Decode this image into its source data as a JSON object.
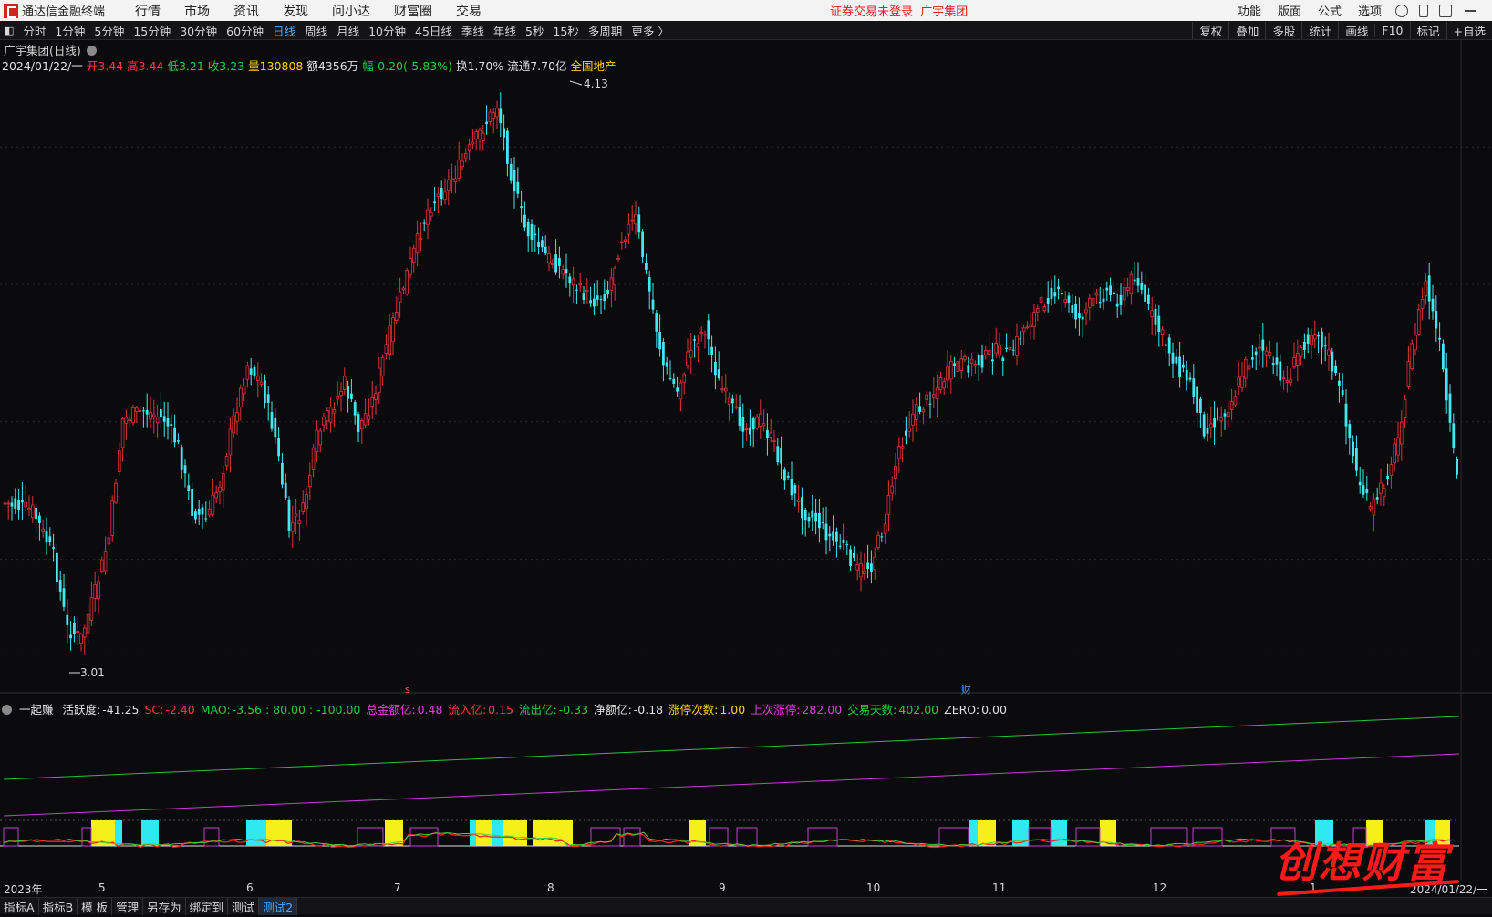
{
  "app": {
    "title": "通达信金融终端",
    "login_status": "证券交易未登录",
    "stock_title": "广宇集团"
  },
  "menu": [
    "行情",
    "市场",
    "资讯",
    "发现",
    "问小达",
    "财富圈",
    "交易"
  ],
  "top_right": [
    "功能",
    "版面",
    "公式",
    "选项"
  ],
  "periods": [
    "分时",
    "1分钟",
    "5分钟",
    "15分钟",
    "30分钟",
    "60分钟",
    "日线",
    "周线",
    "月线",
    "10分钟",
    "45日线",
    "季线",
    "年线",
    "5秒",
    "15秒",
    "多周期",
    "更多 〉"
  ],
  "active_period": "日线",
  "right_tools": [
    "复权",
    "叠加",
    "多股",
    "统计",
    "画线",
    "F10",
    "标记",
    "+自选"
  ],
  "chart_header": {
    "name": "广宇集团(日线)"
  },
  "quote": {
    "date": "2024/01/22/一",
    "open_label": "开",
    "open": "3.44",
    "high_label": "高",
    "high": "3.44",
    "low_label": "低",
    "low": "3.21",
    "close_label": "收",
    "close": "3.23",
    "volume_label": "量",
    "volume": "130808",
    "amount_label": "额",
    "amount": "4356万",
    "change_label": "幅",
    "change": "-0.20(-5.83%)",
    "turnover_label": "换",
    "turnover": "1.70%",
    "float_label": "流通",
    "float": "7.70亿",
    "sector": "全国地产"
  },
  "price_annotations": {
    "high": "4.13",
    "low": "3.01"
  },
  "markers": {
    "event1": "s",
    "event2": "财"
  },
  "indicator": {
    "name": "一起赚",
    "items": [
      {
        "label": "活跃度:",
        "value": "-41.25",
        "color": "w"
      },
      {
        "label": "SC:",
        "value": "-2.40",
        "color": "r"
      },
      {
        "label": "MAO:",
        "value": "-3.56 : 80.00 : -100.00",
        "color": "g"
      },
      {
        "label": "总金额亿:",
        "value": "0.48",
        "color": "m"
      },
      {
        "label": "流入亿:",
        "value": "0.15",
        "color": "r"
      },
      {
        "label": "流出亿:",
        "value": "-0.33",
        "color": "g"
      },
      {
        "label": "净额亿:",
        "value": "-0.18",
        "color": "w"
      },
      {
        "label": "涨停次数:",
        "value": "1.00",
        "color": "y"
      },
      {
        "label": "上次涨停:",
        "value": "282.00",
        "color": "m"
      },
      {
        "label": "交易天数:",
        "value": "402.00",
        "color": "g"
      },
      {
        "label": "ZERO:",
        "value": "0.00",
        "color": "w"
      }
    ]
  },
  "date_axis": {
    "year": "2023年",
    "months": [
      "5",
      "6",
      "7",
      "8",
      "9",
      "10",
      "11",
      "12",
      "1"
    ],
    "last_date": "2024/01/22/一"
  },
  "bottom_tabs": [
    "指标A",
    "指标B",
    "模 板",
    "管理",
    "另存为",
    "绑定到",
    "测试",
    "测试2"
  ],
  "active_tab": "测试2",
  "watermark": "创想财富",
  "colors": {
    "up": "#e0303a",
    "down": "#40e8f0",
    "background": "#0b0b0d"
  }
}
